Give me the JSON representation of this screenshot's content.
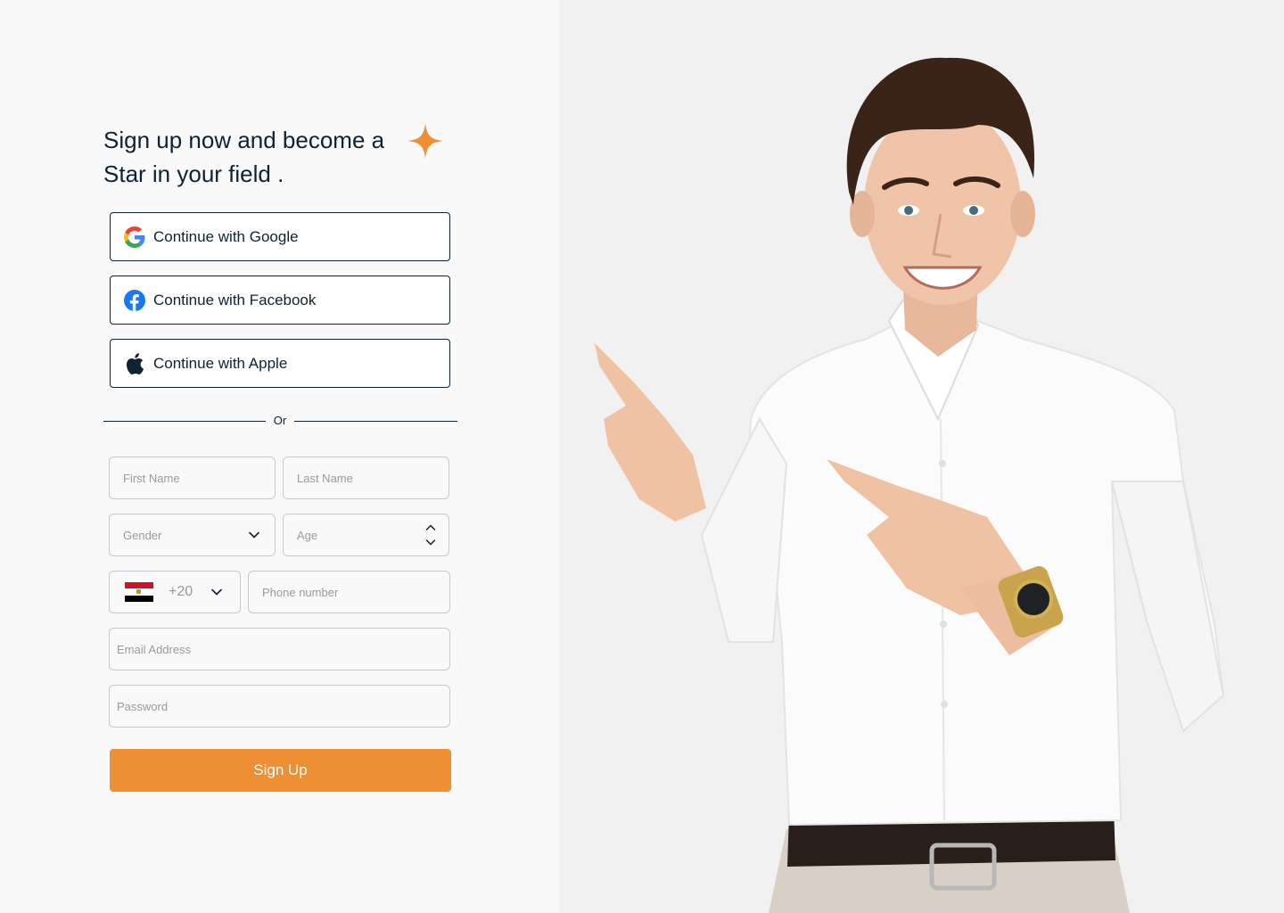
{
  "headline": {
    "line1": "Sign up now and become a",
    "line2": "Star in your field ."
  },
  "social": {
    "google_label": "Continue with Google",
    "facebook_label": "Continue with Facebook",
    "apple_label": "Continue with Apple"
  },
  "divider": {
    "text": "Or"
  },
  "form": {
    "first_name_placeholder": "First Name",
    "last_name_placeholder": "Last Name",
    "gender_placeholder": "Gender",
    "age_placeholder": "Age",
    "country_code": "+20",
    "phone_placeholder": "Phone number",
    "email_placeholder": "Email Address",
    "password_placeholder": "Password",
    "submit_label": "Sign Up"
  },
  "icons": {
    "star": "star-icon",
    "google": "google-icon",
    "facebook": "facebook-icon",
    "apple": "apple-icon",
    "chevron": "chevron-down-icon",
    "flag": "egypt-flag-icon"
  },
  "colors": {
    "accent": "#ee8f33",
    "text": "#0e2233",
    "border": "#c9c9c9",
    "facebook": "#1877f2"
  }
}
